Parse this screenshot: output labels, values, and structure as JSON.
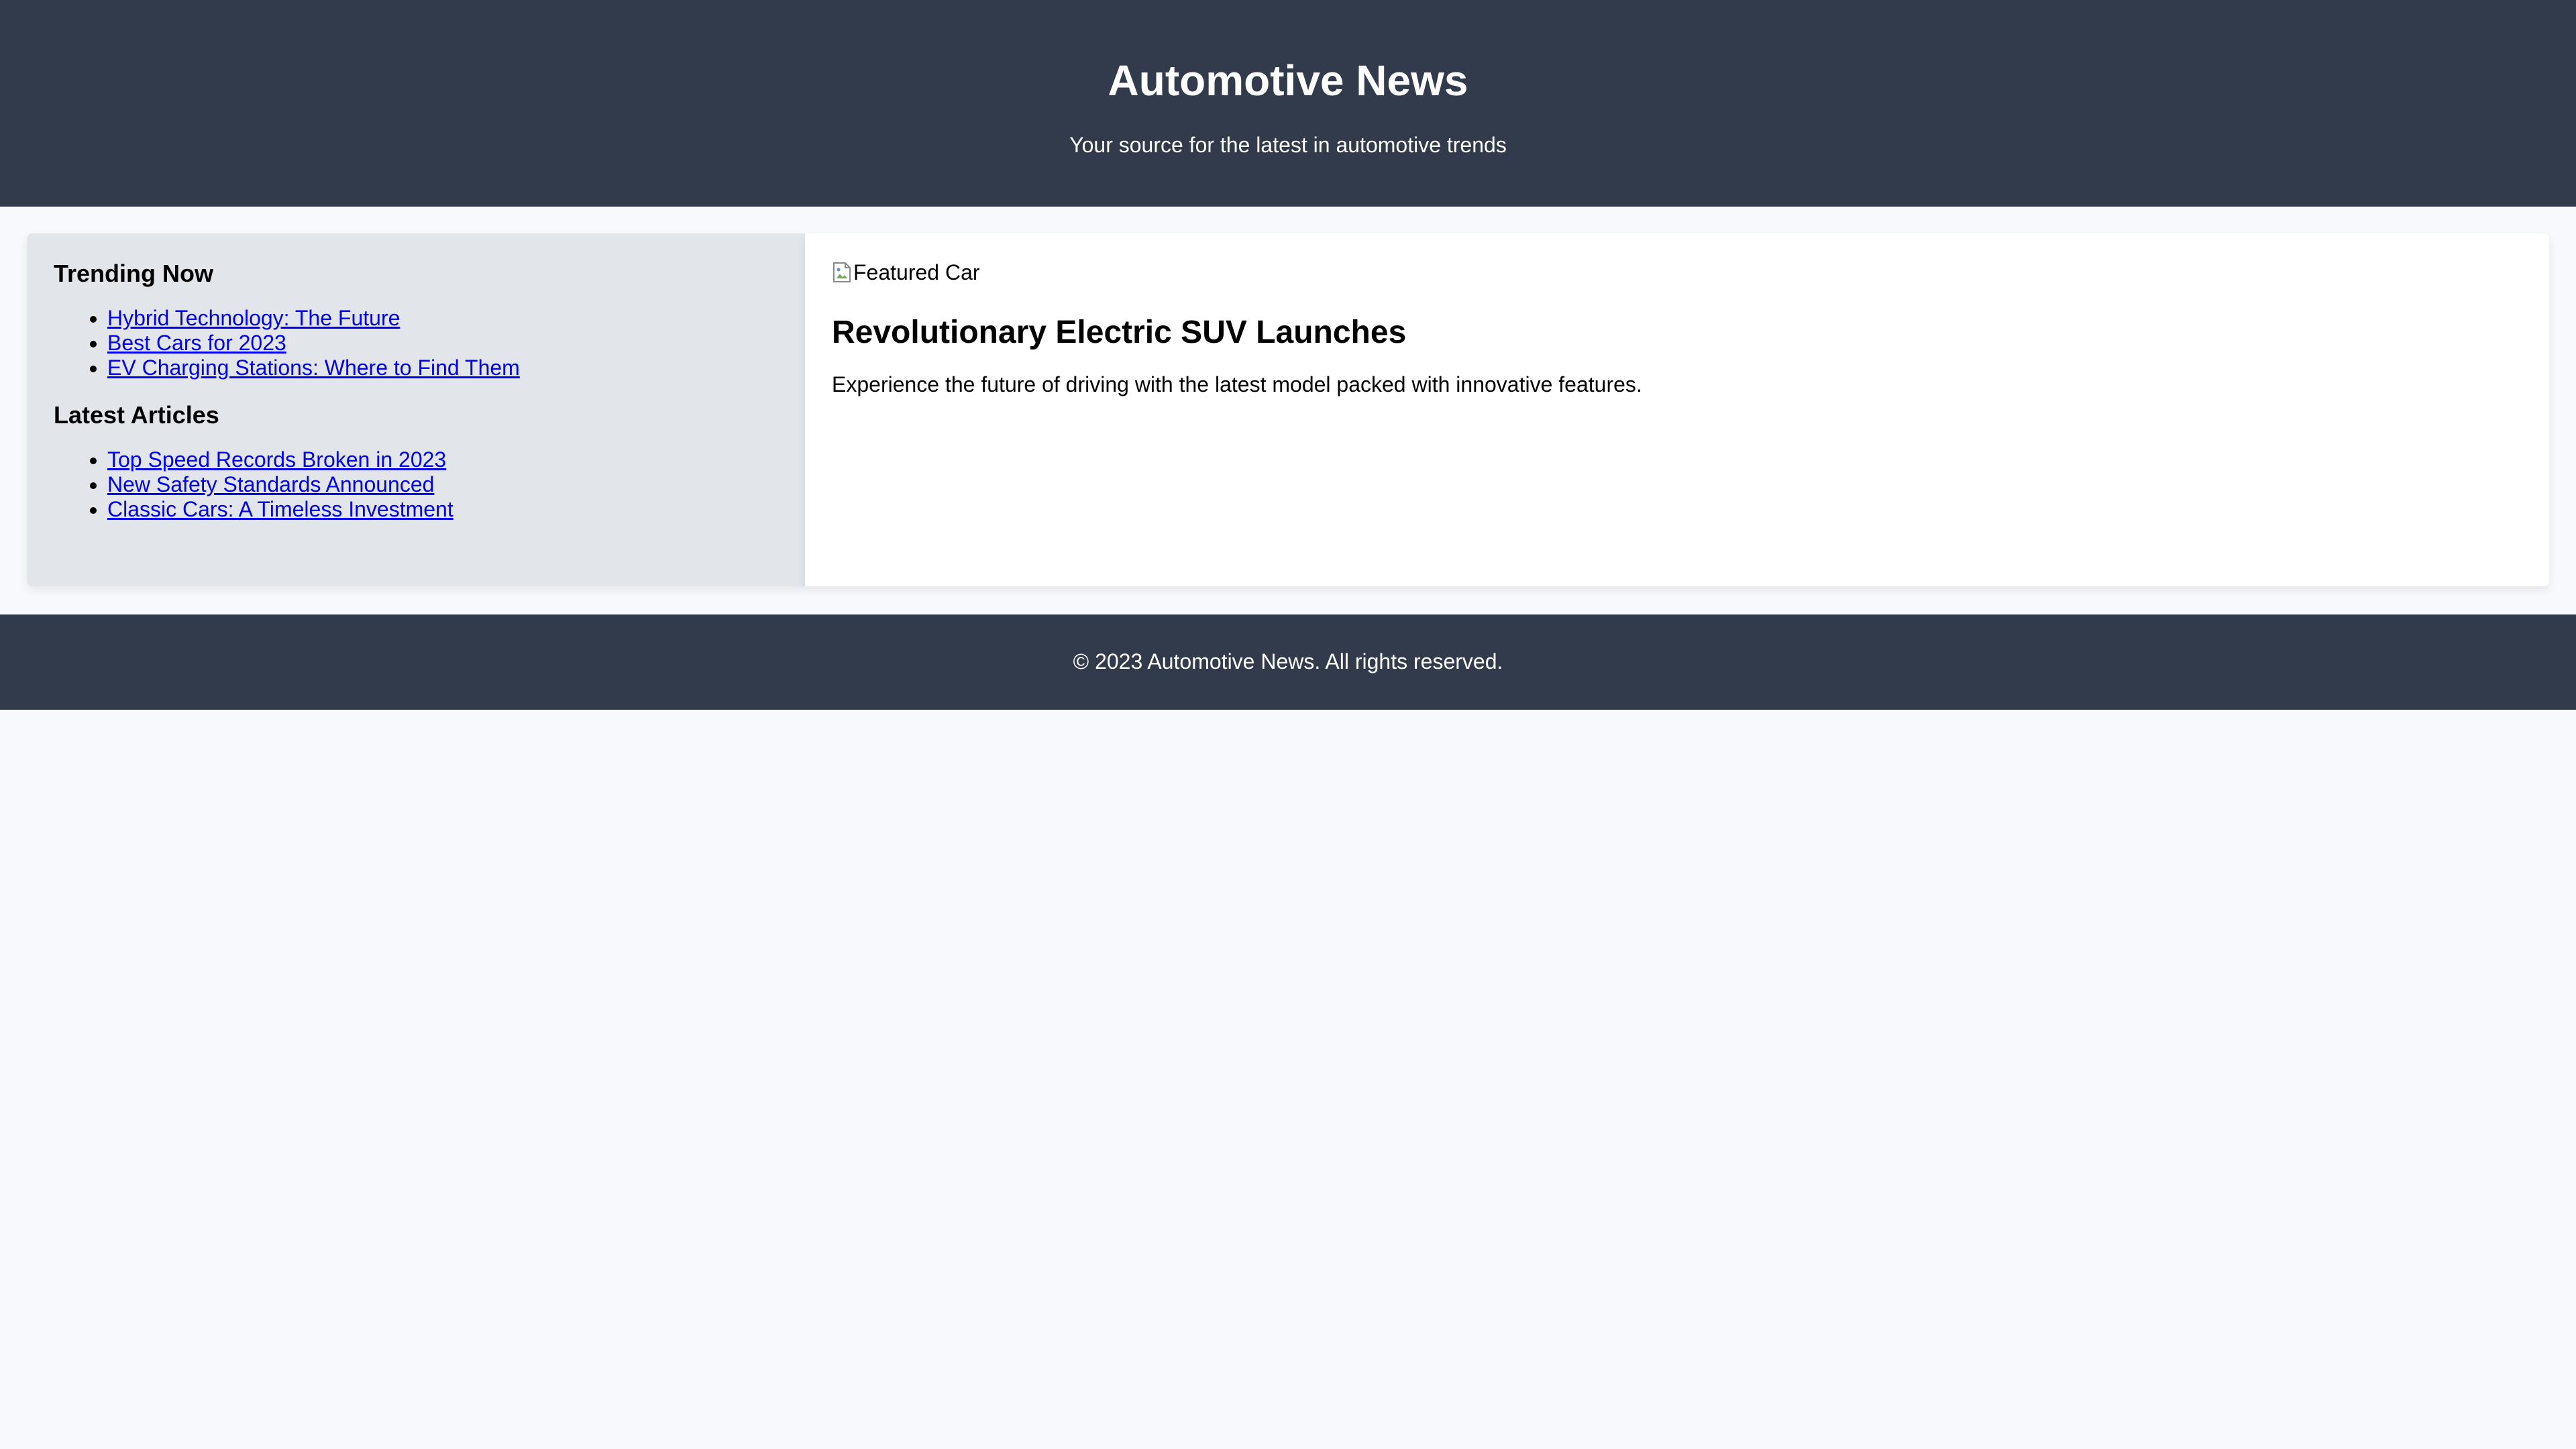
{
  "header": {
    "title": "Automotive News",
    "tagline": "Your source for the latest in automotive trends"
  },
  "sidebar": {
    "trending": {
      "heading": "Trending Now",
      "links": [
        "Hybrid Technology: The Future",
        "Best Cars for 2023",
        "EV Charging Stations: Where to Find Them"
      ]
    },
    "latest": {
      "heading": "Latest Articles",
      "links": [
        "Top Speed Records Broken in 2023",
        "New Safety Standards Announced",
        "Classic Cars: A Timeless Investment"
      ]
    }
  },
  "featured": {
    "image_alt": "Featured Car",
    "image_icon": "broken-image-icon",
    "title": "Revolutionary Electric SUV Launches",
    "summary": "Experience the future of driving with the latest model packed with innovative features."
  },
  "footer": {
    "copyright": "© 2023 Automotive News. All rights reserved."
  },
  "colors": {
    "header_bg": "#323b4b",
    "page_bg": "#f7f9fc",
    "sidebar_bg": "#e2e5ea",
    "link": "#0000ee"
  }
}
